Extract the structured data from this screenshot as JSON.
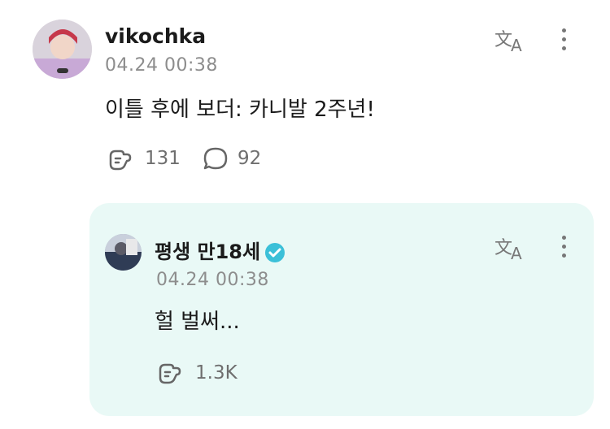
{
  "post": {
    "username": "vikochka",
    "timestamp": "04.24 00:38",
    "text": "이틀 후에 보더: 카니발 2주년!",
    "like_count": "131",
    "comment_count": "92",
    "translate_icon": "translate-icon",
    "more_icon": "more-vertical-icon"
  },
  "reply": {
    "username": "평생 만18세",
    "verified_icon": "verified-badge-icon",
    "timestamp": "04.24 00:38",
    "text": "헐 벌써...",
    "like_count": "1.3K",
    "translate_icon": "translate-icon",
    "more_icon": "more-vertical-icon",
    "background_color": "#e9f9f6"
  },
  "colors": {
    "username": "#1b1b1b",
    "timestamp": "#8d8d8d",
    "verified": "#3bc0d8"
  }
}
